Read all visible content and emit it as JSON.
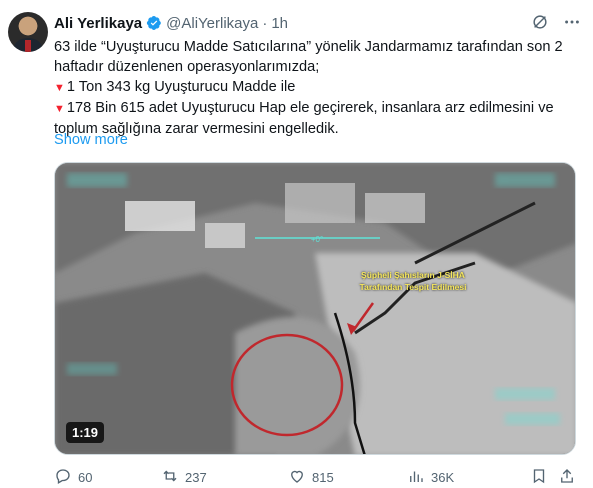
{
  "author": {
    "name": "Ali Yerlikaya",
    "handle": "@AliYerlikaya",
    "separator": "·",
    "time": "1h"
  },
  "tweet": {
    "line1": "63 ilde “Uyuşturucu Madde Satıcılarına” yönelik Jandarmamız tarafından son 2 haftadır düzenlenen operasyonlarımızda;",
    "bullet1": "1 Ton 343 kg Uyuşturucu Madde ile",
    "bullet2": "178 Bin 615 adet Uyuşturucu Hap ele geçirerek, insanlara arz edilmesini ve toplum sağlığına zarar vermesini engelledik.",
    "bullet_marker": "▼",
    "show_more": "Show more"
  },
  "media": {
    "overlay_line1": "Şüpheli Şahısların J-SİHA",
    "overlay_line2": "Tarafından Tespit Edilmesi",
    "duration": "1:19"
  },
  "actions": {
    "replies": "60",
    "retweets": "237",
    "likes": "815",
    "views": "36K"
  },
  "icons": {
    "verified": "verified-badge-icon",
    "grok": "grok-icon",
    "more": "more-icon",
    "reply": "reply-icon",
    "retweet": "retweet-icon",
    "like": "heart-icon",
    "views": "views-icon",
    "bookmark": "bookmark-icon",
    "share": "share-icon"
  },
  "colors": {
    "link": "#1d9bf0",
    "muted": "#536471",
    "verified": "#1d9bf0",
    "bullet": "#f4212e"
  }
}
